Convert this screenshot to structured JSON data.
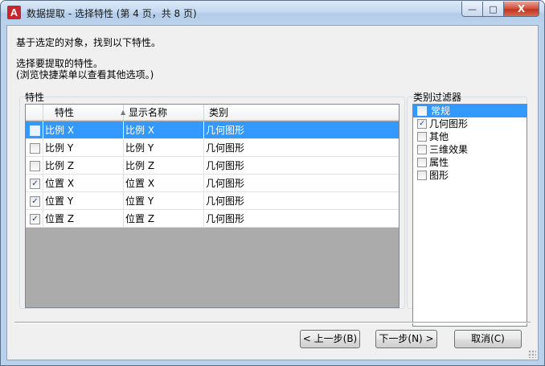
{
  "window": {
    "title": "数据提取 - 选择特性 (第 4 页，共 8 页)",
    "icon_letter": "A",
    "controls": {
      "minimize": "—",
      "maximize": "□",
      "close": "X"
    }
  },
  "instructions": {
    "line1": "基于选定的对象，找到以下特性。",
    "line2": "选择要提取的特性。",
    "line3": "(浏览快捷菜单以查看其他选项。)"
  },
  "properties": {
    "group_label": "特性",
    "columns": {
      "property": "特性",
      "display_name": "显示名称",
      "category": "类别"
    },
    "rows": [
      {
        "checked": false,
        "property": "比例 X",
        "display_name": "比例 X",
        "category": "几何图形",
        "selected": true
      },
      {
        "checked": false,
        "property": "比例 Y",
        "display_name": "比例 Y",
        "category": "几何图形",
        "selected": false
      },
      {
        "checked": false,
        "property": "比例 Z",
        "display_name": "比例 Z",
        "category": "几何图形",
        "selected": false
      },
      {
        "checked": true,
        "property": "位置 X",
        "display_name": "位置 X",
        "category": "几何图形",
        "selected": false
      },
      {
        "checked": true,
        "property": "位置 Y",
        "display_name": "位置 Y",
        "category": "几何图形",
        "selected": false
      },
      {
        "checked": true,
        "property": "位置 Z",
        "display_name": "位置 Z",
        "category": "几何图形",
        "selected": false
      }
    ]
  },
  "category_filter": {
    "group_label": "类别过滤器",
    "items": [
      {
        "label": "常规",
        "checked": false,
        "selected": true
      },
      {
        "label": "几何图形",
        "checked": true,
        "selected": false
      },
      {
        "label": "其他",
        "checked": false,
        "selected": false
      },
      {
        "label": "三维效果",
        "checked": false,
        "selected": false
      },
      {
        "label": "属性",
        "checked": false,
        "selected": false
      },
      {
        "label": "图形",
        "checked": false,
        "selected": false
      }
    ]
  },
  "buttons": {
    "prev": "< 上一步(B)",
    "next": "下一步(N) >",
    "cancel": "取消(C)"
  },
  "colors": {
    "selection": "#3399ff",
    "grid_empty": "#ababab",
    "dialog_bg": "#f0f0f0"
  }
}
